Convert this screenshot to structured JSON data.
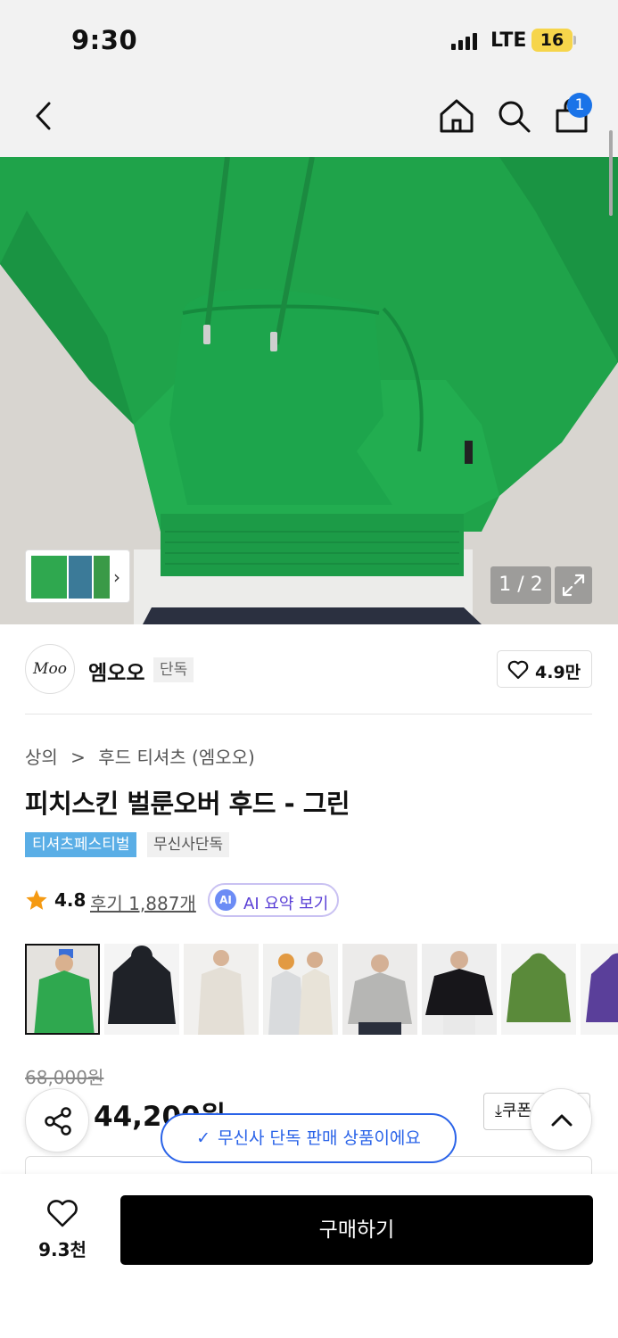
{
  "status": {
    "time": "9:30",
    "network": "LTE",
    "battery": "16"
  },
  "nav": {
    "cart_count": "1"
  },
  "gallery": {
    "counter": "1 / 2"
  },
  "brand": {
    "logo_text": "Moo",
    "name": "엠오오",
    "tag": "단독",
    "likes": "4.9만"
  },
  "breadcrumb": [
    "상의",
    ">",
    "후드 티셔츠 (엠오오)"
  ],
  "product": {
    "title": "피치스킨 벌룬오버 후드 - 그린",
    "badges": [
      "티셔츠페스티벌",
      "무신사단독"
    ],
    "rating": "4.8",
    "reviews": "후기 1,887개",
    "ai_icon": "AI",
    "ai_summary": "AI 요약 보기",
    "original_price": "68,000원",
    "price": "44,200원",
    "coupon": "⤓쿠폰"
  },
  "variants": [
    {
      "color": "#2fa84f",
      "label": "green"
    },
    {
      "color": "#1f2228",
      "label": "black"
    },
    {
      "color": "#e9e4dc",
      "label": "ivory"
    },
    {
      "color": "#dcdedf",
      "label": "light-grey"
    },
    {
      "color": "#b9b9b7",
      "label": "grey"
    },
    {
      "color": "#17161a",
      "label": "black-2"
    },
    {
      "color": "#5a8a3a",
      "label": "khaki"
    },
    {
      "color": "#5a3f9a",
      "label": "purple"
    }
  ],
  "toast": {
    "text": "무신사 단독 판매 상품이에요"
  },
  "bottom": {
    "wish_count": "9.3천",
    "buy_label": "구매하기"
  },
  "colors": {
    "hoodie": "#1fa34a",
    "accent_blue": "#2a63e8",
    "badge_blue": "#5aaee6"
  }
}
